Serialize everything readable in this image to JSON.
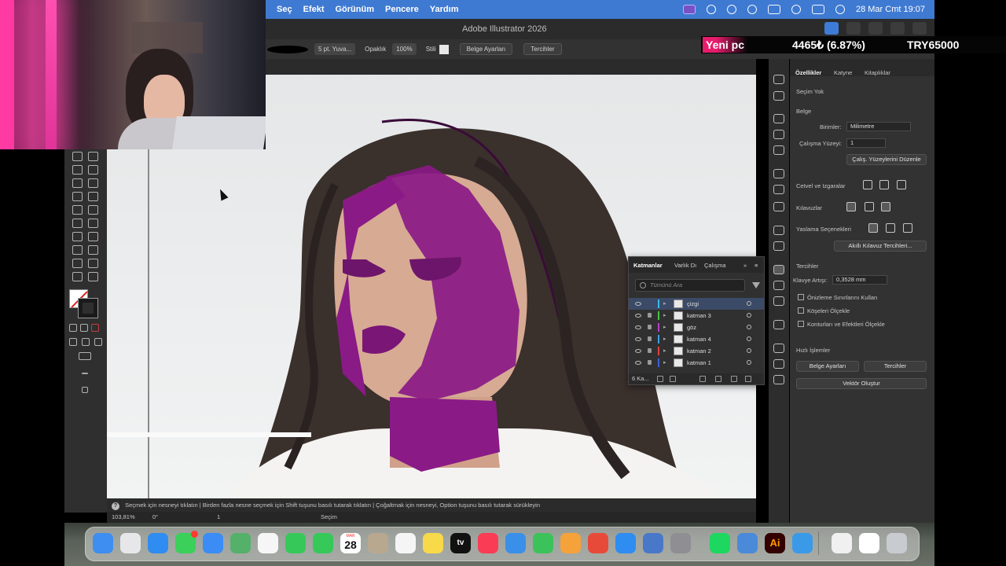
{
  "menubar": {
    "items": [
      "Seç",
      "Efekt",
      "Görünüm",
      "Pencere",
      "Yardım"
    ],
    "clock": "28 Mar Cmt  19:07"
  },
  "window": {
    "title": "Adobe Illustrator 2026"
  },
  "ticker": {
    "label": "Yeni pc",
    "value": "4465₺ (6.87%)",
    "goal": "TRY65000"
  },
  "controlbar": {
    "brush": "5 pt. Yuva...",
    "opacity_label": "Opaklık",
    "opacity_value": "100%",
    "style_label": "Stili",
    "doc_setup": "Belge Ayarları",
    "prefs": "Tercihler"
  },
  "properties": {
    "tabs": [
      "Özellikler",
      "Katyne",
      "Kitaplıklar"
    ],
    "selection": "Seçim Yok",
    "document": "Belge",
    "units_label": "Birimler:",
    "units_value": "Milimetre",
    "artboard_label": "Çalışma Yüzeyi:",
    "artboard_value": "1",
    "edit_artboards": "Çalış. Yüzeylerini Düzenle",
    "rulers_grids": "Cetvel ve Izgaralar",
    "guides": "Kılavuzlar",
    "snap_options": "Yaslama Seçenekleri",
    "smart_guides_prefs": "Akıllı Kılavuz Tercihleri...",
    "preferences": "Tercihler",
    "keyboard_increment_label": "Klavye Artışı:",
    "keyboard_increment_value": "0,3528 mm",
    "checkbox_preview_bounds": "Önizleme Sınırlarını Kullan",
    "checkbox_corners": "Köşeleri Ölçekle",
    "checkbox_strokes": "Konturları ve Efektleri Ölçekle",
    "quick_actions": "Hızlı İşlemler",
    "btn_doc_setup": "Belge Ayarları",
    "btn_prefs": "Tercihler",
    "btn_vectorize": "Vektör Oluştur"
  },
  "layers": {
    "tabs": [
      "Katmanlar",
      "Varlık Dı",
      "Çalışma"
    ],
    "search_placeholder": "Tümünü Ara",
    "rows": [
      {
        "name": "çizgi",
        "color": "#3fb8e8",
        "selected": true
      },
      {
        "name": "katman 3",
        "color": "#47c24a",
        "selected": false
      },
      {
        "name": "göz",
        "color": "#b040c8",
        "selected": false
      },
      {
        "name": "katman 4",
        "color": "#3aa0e8",
        "selected": false
      },
      {
        "name": "katman 2",
        "color": "#e04040",
        "selected": false
      },
      {
        "name": "katman 1",
        "color": "#4060d8",
        "selected": false
      }
    ],
    "count": "6 Ka..."
  },
  "hintbar": {
    "text": "Seçmek için nesneyi tıklatın  |  Birden fazla nesne seçmek için Shift tuşunu basılı tutarak tıklatın  |  Çoğaltmak için nesneyi, Option tuşunu basılı tutarak sürükleyin"
  },
  "statusbar": {
    "zoom": "103,81%",
    "rotation": "0°",
    "artboard": "1",
    "tool": "Seçim"
  },
  "dock": {
    "apps": [
      {
        "name": "finder",
        "color": "#3d8ef0"
      },
      {
        "name": "launchpad",
        "color": "#e7e7ea"
      },
      {
        "name": "safari",
        "color": "#2f8cf0"
      },
      {
        "name": "messages",
        "color": "#3ad05a"
      },
      {
        "name": "mail",
        "color": "#3b8cf5"
      },
      {
        "name": "maps",
        "color": "#55b06a"
      },
      {
        "name": "photos",
        "color": "#f6f6f6"
      },
      {
        "name": "facetime",
        "color": "#36c95a"
      },
      {
        "name": "phone",
        "color": "#36c95a"
      },
      {
        "name": "calendar",
        "color": "#ffffff"
      },
      {
        "name": "contacts",
        "color": "#b8a890"
      },
      {
        "name": "reminders",
        "color": "#f5f5f5"
      },
      {
        "name": "notes",
        "color": "#f8d94a"
      },
      {
        "name": "tv",
        "color": "#111111"
      },
      {
        "name": "music",
        "color": "#fa3c55"
      },
      {
        "name": "keynote",
        "color": "#3a90e8"
      },
      {
        "name": "numbers",
        "color": "#3cc25a"
      },
      {
        "name": "pages",
        "color": "#f5a23a"
      },
      {
        "name": "rocket",
        "color": "#e84a3a"
      },
      {
        "name": "app-store",
        "color": "#2f8cf0"
      },
      {
        "name": "preview",
        "color": "#4a78c8"
      },
      {
        "name": "system-settings",
        "color": "#8e8e93"
      },
      {
        "name": "spotify",
        "color": "#1ed760"
      },
      {
        "name": "finder-2",
        "color": "#4a8ad8"
      },
      {
        "name": "illustrator",
        "color": "#330000"
      },
      {
        "name": "vpn",
        "color": "#3a9ae8"
      },
      {
        "name": "document",
        "color": "#f0f0f0"
      },
      {
        "name": "screenshot",
        "color": "#ffffff"
      },
      {
        "name": "trash",
        "color": "#c8ccd0"
      }
    ],
    "calendar_day": "28",
    "calendar_month": "MAR",
    "tv_label": "tv",
    "ai_label": "Ai"
  },
  "colors": {
    "accent_purple": "#8a1a86",
    "menubar_blue": "#3f7ad2",
    "ticker_pink": "#e81c6d"
  }
}
